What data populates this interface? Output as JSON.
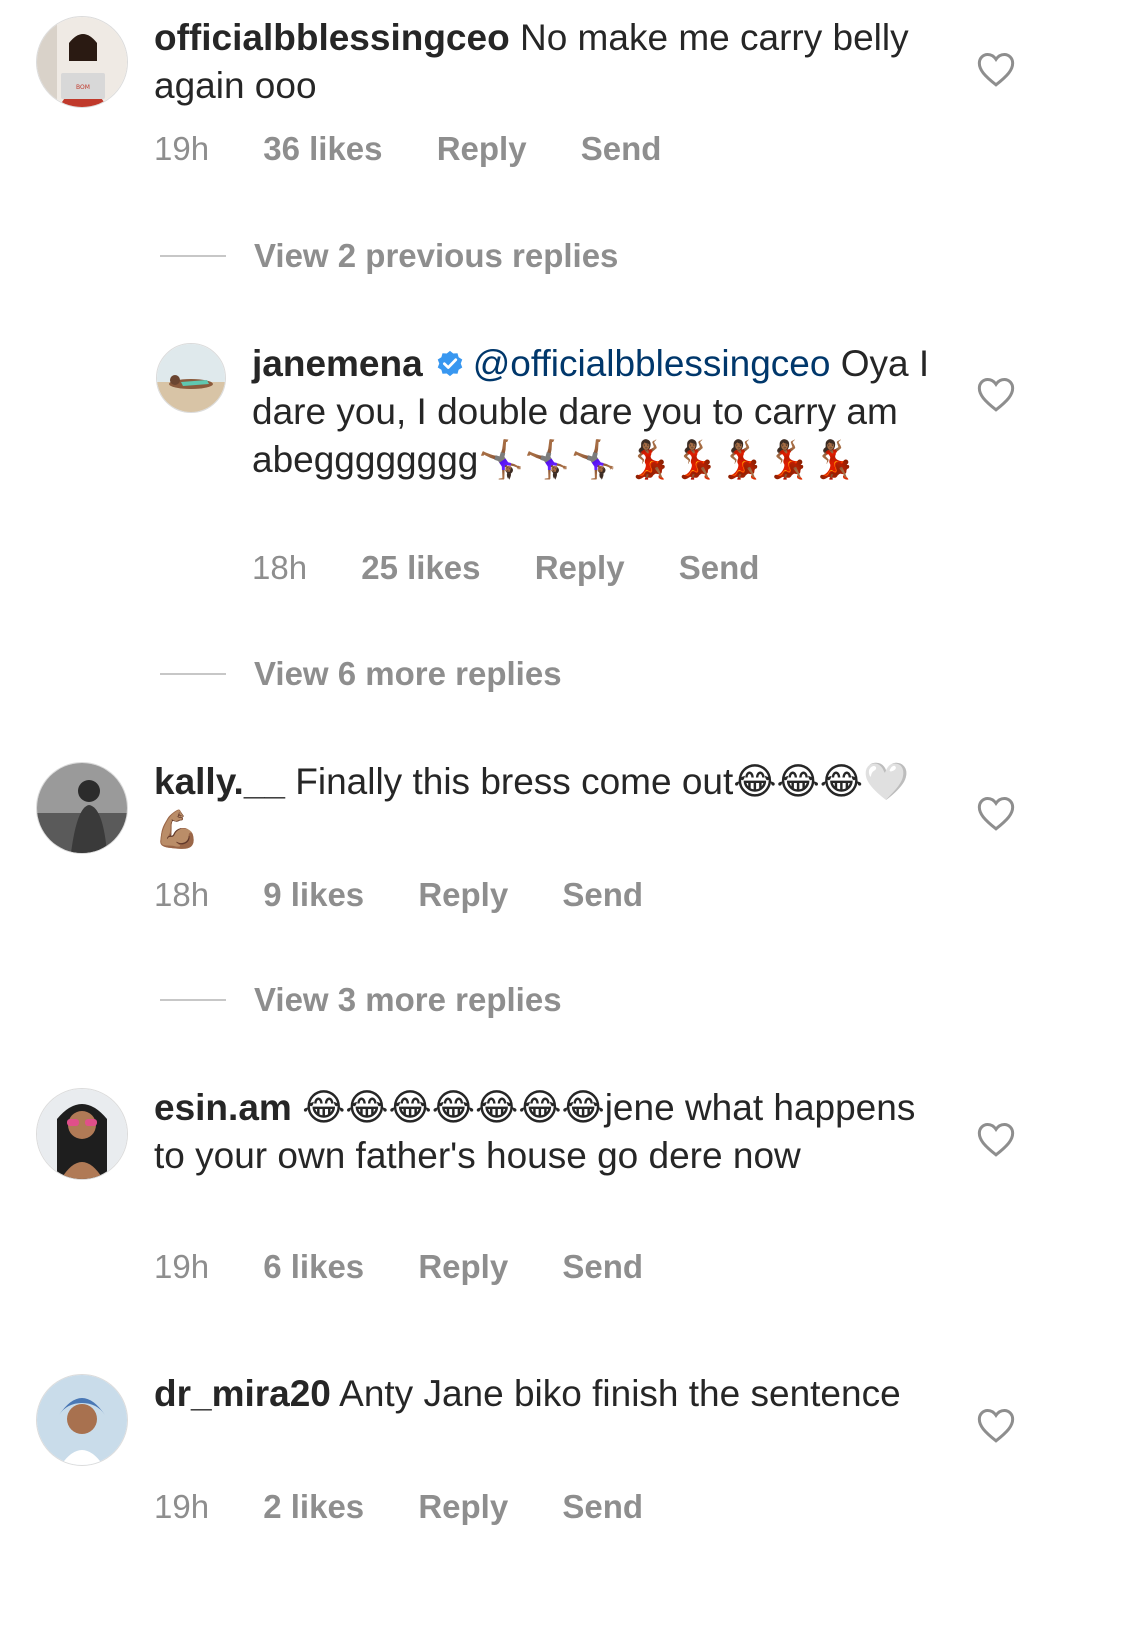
{
  "comments": [
    {
      "username": "officialbblessingceo",
      "text": "No make me carry belly again ooo",
      "time": "19h",
      "likes": "36 likes",
      "reply": "Reply",
      "send": "Send",
      "avatar": "woman-at-laptop",
      "avatar_laptop_label": "BOM"
    },
    {
      "username": "janemena",
      "verified": true,
      "mention": "@officialbblessingceo",
      "text": "Oya  I dare you, I double dare you to carry am abegggggggg🤸🏾‍♀️🤸🏾‍♀️🤸🏾‍♀️ 💃🏾💃🏾💃🏾💃🏾💃🏾",
      "time": "18h",
      "likes": "25 likes",
      "reply": "Reply",
      "send": "Send",
      "avatar": "woman-on-beach"
    },
    {
      "username": "kally.__",
      "text": "Finally this bress come out😂😂😂🤍💪🏽",
      "time": "18h",
      "likes": "9 likes",
      "reply": "Reply",
      "send": "Send",
      "avatar": "man-grayscale"
    },
    {
      "username": "esin.am",
      "text": "😂😂😂😂😂😂😂jene what happens to your own father's house go dere now",
      "time": "19h",
      "likes": "6 likes",
      "reply": "Reply",
      "send": "Send",
      "avatar": "woman-sunglasses"
    },
    {
      "username": "dr_mira20",
      "text": "Anty Jane biko finish the sentence",
      "time": "19h",
      "likes": "2 likes",
      "reply": "Reply",
      "send": "Send",
      "avatar": "woman-headscarf"
    }
  ],
  "view_replies": [
    "View 2 previous replies",
    "View 6 more replies",
    "View 3 more replies"
  ],
  "colors": {
    "text": "#262626",
    "meta": "#8e8e8e",
    "mention": "#00376b",
    "verified": "#3897f0",
    "divider": "#c7c7c7"
  }
}
